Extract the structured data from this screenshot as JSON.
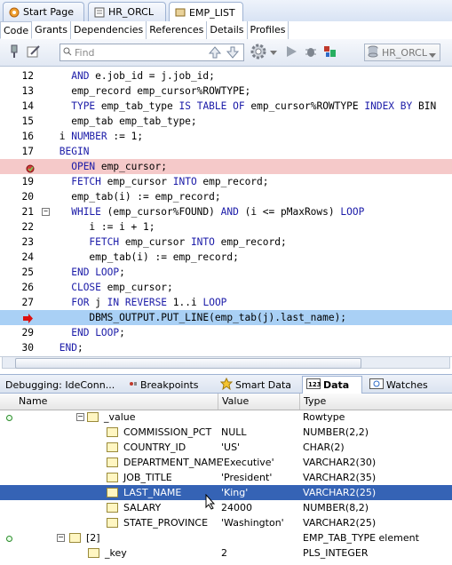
{
  "editor_tabs": [
    {
      "label": "Start Page",
      "icon": "start-page-icon"
    },
    {
      "label": "HR_ORCL",
      "icon": "sql-worksheet-icon"
    },
    {
      "label": "EMP_LIST",
      "icon": "procedure-icon",
      "active": true
    }
  ],
  "sub_tabs": [
    "Code",
    "Grants",
    "Dependencies",
    "References",
    "Details",
    "Profiles"
  ],
  "toolbar": {
    "find_placeholder": "Find",
    "connection": "HR_ORCL"
  },
  "code_lines": [
    {
      "ln": "12",
      "text": "   AND e.job_id = j.job_id;"
    },
    {
      "ln": "13",
      "text": "   emp_record emp_cursor%ROWTYPE;"
    },
    {
      "ln": "14",
      "text": "   TYPE emp_tab_type IS TABLE OF emp_cursor%ROWTYPE INDEX BY BIN"
    },
    {
      "ln": "15",
      "text": "   emp_tab emp_tab_type;"
    },
    {
      "ln": "16",
      "text": " i NUMBER := 1;"
    },
    {
      "ln": "17",
      "text": " BEGIN"
    },
    {
      "ln": "",
      "text": "   OPEN emp_cursor;",
      "highlight": "breakpoint"
    },
    {
      "ln": "19",
      "text": "   FETCH emp_cursor INTO emp_record;"
    },
    {
      "ln": "20",
      "text": "   emp_tab(i) := emp_record;"
    },
    {
      "ln": "21",
      "text": "   WHILE (emp_cursor%FOUND) AND (i <= pMaxRows) LOOP"
    },
    {
      "ln": "22",
      "text": "      i := i + 1;"
    },
    {
      "ln": "23",
      "text": "      FETCH emp_cursor INTO emp_record;"
    },
    {
      "ln": "24",
      "text": "      emp_tab(i) := emp_record;"
    },
    {
      "ln": "25",
      "text": "   END LOOP;"
    },
    {
      "ln": "26",
      "text": "   CLOSE emp_cursor;"
    },
    {
      "ln": "27",
      "text": "   FOR j IN REVERSE 1..i LOOP"
    },
    {
      "ln": "",
      "text": "      DBMS_OUTPUT.PUT_LINE(emp_tab(j).last_name);",
      "highlight": "current"
    },
    {
      "ln": "29",
      "text": "   END LOOP;"
    },
    {
      "ln": "30",
      "text": " END;"
    }
  ],
  "debug_tabs": [
    {
      "label": "Debugging: IdeConn...",
      "icon": ""
    },
    {
      "label": "Breakpoints",
      "icon": "breakpoints-icon"
    },
    {
      "label": "Smart Data",
      "icon": "smart-data-icon"
    },
    {
      "label": "Data",
      "icon": "data-icon",
      "active": true
    },
    {
      "label": "Watches",
      "icon": "watches-icon"
    }
  ],
  "grid": {
    "columns": [
      "Name",
      "Value",
      "Type"
    ],
    "rows": [
      {
        "name": "_value",
        "value": "",
        "type": "Rowtype",
        "level": 0
      },
      {
        "name": "COMMISSION_PCT",
        "value": "NULL",
        "type": "NUMBER(2,2)",
        "level": 1
      },
      {
        "name": "COUNTRY_ID",
        "value": "'US'",
        "type": "CHAR(2)",
        "level": 1
      },
      {
        "name": "DEPARTMENT_NAME",
        "value": "'Executive'",
        "type": "VARCHAR2(30)",
        "level": 1
      },
      {
        "name": "JOB_TITLE",
        "value": "'President'",
        "type": "VARCHAR2(35)",
        "level": 1
      },
      {
        "name": "LAST_NAME",
        "value": "'King'",
        "type": "VARCHAR2(25)",
        "level": 1,
        "selected": true
      },
      {
        "name": "SALARY",
        "value": "24000",
        "type": "NUMBER(8,2)",
        "level": 1
      },
      {
        "name": "STATE_PROVINCE",
        "value": "'Washington'",
        "type": "VARCHAR2(25)",
        "level": 1
      },
      {
        "name": "[2]",
        "value": "",
        "type": "EMP_TAB_TYPE element",
        "level": -1
      },
      {
        "name": "_key",
        "value": "2",
        "type": "PLS_INTEGER",
        "level": 0
      }
    ]
  }
}
